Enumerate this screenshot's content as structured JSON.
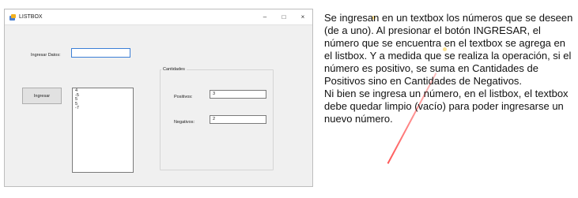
{
  "window": {
    "title": "LISTBOX",
    "controls": {
      "minimize": "–",
      "maximize": "□",
      "close": "×"
    }
  },
  "form": {
    "ingresar_label": "Ingresar Datos:",
    "ingresar_value": "",
    "button_label": "Ingresar",
    "list_items": [
      "4",
      "-5",
      "5",
      "5",
      "-7"
    ],
    "group_label": "Cantidades",
    "positivos_label": "Positivos:",
    "positivos_value": "3",
    "negativos_label": "Negativos:",
    "negativos_value": "2"
  },
  "description": {
    "paragraph1": "Se ingresan en un textbox los números que se deseen (de a uno). Al presionar el botón INGRESAR, el número que se encuentra en el textbox se agrega en el listbox. Y a medida que se realiza la operación, si el número es positivo, se suma en Cantidades de Positivos sino en Cantidades de Negativos.",
    "paragraph2": "Ni bien se ingresa un número, en el listbox, el textbox debe quedar limpio (vacío) para poder ingresarse un nuevo número."
  },
  "colors": {
    "accent": "#3c7fd6",
    "window_bg": "#f0f0f0",
    "watermark_red": "#ff2d2d"
  },
  "icons": {
    "app": "app-window-icon",
    "minimize": "minimize-icon",
    "maximize": "maximize-icon",
    "close": "close-icon"
  }
}
